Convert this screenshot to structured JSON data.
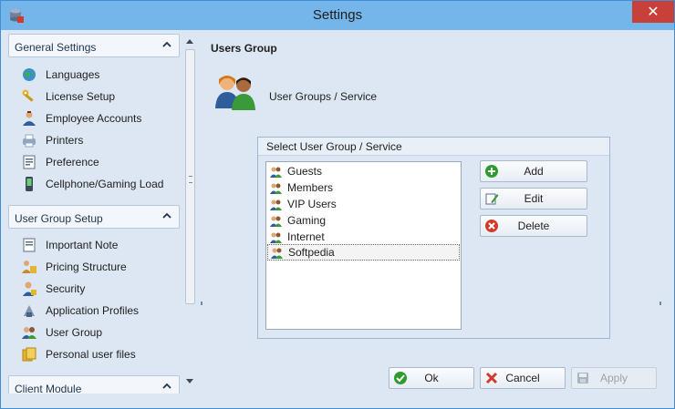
{
  "window": {
    "title": "Settings",
    "close_glyph": "✕",
    "app_icon": "database-icon"
  },
  "sidebar": {
    "groups": [
      {
        "label": "General Settings",
        "items": [
          {
            "label": "Languages",
            "icon": "globe-icon"
          },
          {
            "label": "License Setup",
            "icon": "keys-icon"
          },
          {
            "label": "Employee Accounts",
            "icon": "employee-icon"
          },
          {
            "label": "Printers",
            "icon": "printer-icon"
          },
          {
            "label": "Preference",
            "icon": "preference-icon"
          },
          {
            "label": "Cellphone/Gaming Load",
            "icon": "cellphone-icon"
          }
        ]
      },
      {
        "label": "User Group Setup",
        "items": [
          {
            "label": "Important Note",
            "icon": "note-icon"
          },
          {
            "label": "Pricing Structure",
            "icon": "pricing-icon"
          },
          {
            "label": "Security",
            "icon": "security-icon"
          },
          {
            "label": "Application Profiles",
            "icon": "application-icon"
          },
          {
            "label": "User Group",
            "icon": "users-icon"
          },
          {
            "label": "Personal user files",
            "icon": "files-icon"
          }
        ]
      },
      {
        "label": "Client Module",
        "items": []
      }
    ]
  },
  "main": {
    "title": "Users Group",
    "subtitle": "User Groups / Service",
    "groupbox_title": "Select User Group / Service",
    "list": [
      {
        "label": "Guests",
        "selected": false
      },
      {
        "label": "Members",
        "selected": false
      },
      {
        "label": "VIP Users",
        "selected": false
      },
      {
        "label": "Gaming",
        "selected": false
      },
      {
        "label": "Internet",
        "selected": false
      },
      {
        "label": "Softpedia",
        "selected": true
      }
    ],
    "buttons": {
      "add": "Add",
      "edit": "Edit",
      "delete": "Delete"
    }
  },
  "footer": {
    "ok": "Ok",
    "cancel": "Cancel",
    "apply": "Apply",
    "apply_enabled": false
  },
  "colors": {
    "titlebar": "#74b6ea",
    "close": "#c7413a",
    "window_bg": "#dde7f3",
    "add_green": "#2f9b2f",
    "delete_red": "#d23b2b"
  }
}
